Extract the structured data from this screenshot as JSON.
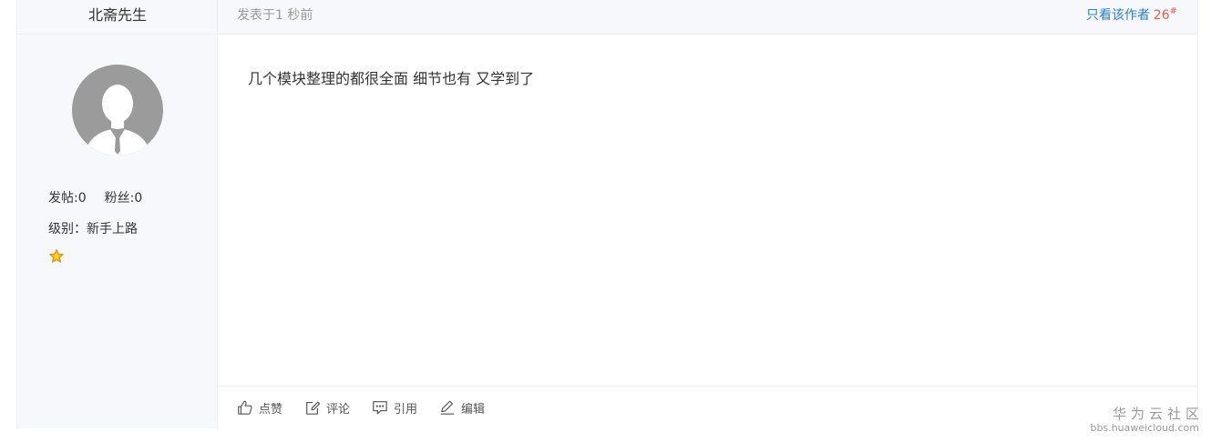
{
  "author": {
    "name": "北斋先生",
    "posts_label": "发帖:0",
    "fans_label": "粉丝:0",
    "level_label": "级别：新手上路",
    "avatar_icon": "default-user-avatar-icon",
    "level_icon": "star-icon"
  },
  "topbar": {
    "post_time": "发表于1 秒前",
    "only_author_label": "只看该作者",
    "floor_number": "26",
    "floor_mark": "#"
  },
  "post": {
    "content": "几个模块整理的都很全面 细节也有 又学到了"
  },
  "actions": {
    "like_label": "点赞",
    "comment_label": "评论",
    "quote_label": "引用",
    "edit_label": "编辑"
  },
  "watermark": {
    "title": "华为云社区",
    "url": "bbs.huaweicloud.com"
  },
  "colors": {
    "link": "#2a7ec9",
    "floor": "#f05a4a",
    "sidebar_bg": "#f7f8fc",
    "star": "#f5b400"
  }
}
